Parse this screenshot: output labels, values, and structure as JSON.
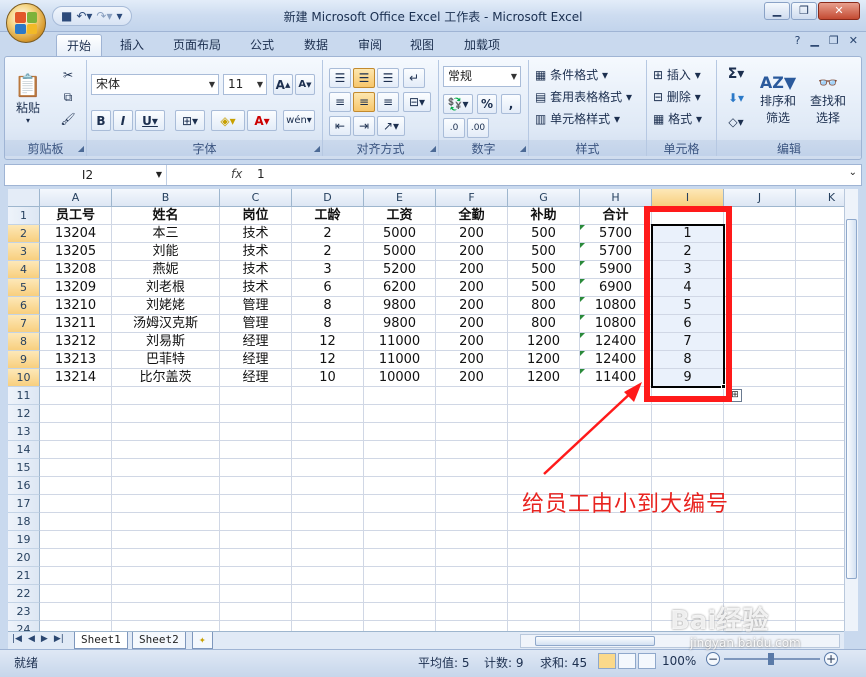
{
  "window": {
    "title": "新建 Microsoft Office Excel 工作表 - Microsoft Excel"
  },
  "ribbon_tabs": [
    "开始",
    "插入",
    "页面布局",
    "公式",
    "数据",
    "审阅",
    "视图",
    "加载项"
  ],
  "ribbon": {
    "clipboard": {
      "paste_label": "粘贴",
      "group_label": "剪贴板"
    },
    "font": {
      "font_name": "宋体",
      "font_size": "11",
      "group_label": "字体"
    },
    "alignment": {
      "group_label": "对齐方式"
    },
    "number": {
      "format": "常规",
      "group_label": "数字"
    },
    "styles": {
      "conditional": "条件格式",
      "table": "套用表格格式",
      "cell_style": "单元格样式",
      "group_label": "样式"
    },
    "cells": {
      "insert": "插入",
      "delete": "删除",
      "format": "格式",
      "group_label": "单元格"
    },
    "editing": {
      "sort_line1": "排序和",
      "sort_line2": "筛选",
      "find_line1": "查找和",
      "find_line2": "选择",
      "group_label": "编辑"
    }
  },
  "formula_bar": {
    "name_box": "I2",
    "fx": "fx",
    "value": "1"
  },
  "columns": [
    "A",
    "B",
    "C",
    "D",
    "E",
    "F",
    "G",
    "H",
    "I",
    "J",
    "K"
  ],
  "rows": [
    "1",
    "2",
    "3",
    "4",
    "5",
    "6",
    "7",
    "8",
    "9",
    "10",
    "11",
    "12",
    "13",
    "14",
    "15",
    "16",
    "17",
    "18",
    "19",
    "20",
    "21",
    "22",
    "23",
    "24"
  ],
  "table": {
    "headers": [
      "员工号",
      "姓名",
      "岗位",
      "工龄",
      "工资",
      "全勤",
      "补助",
      "合计"
    ],
    "data": [
      [
        "13204",
        "本三",
        "技术",
        "2",
        "5000",
        "200",
        "500",
        "5700",
        "1"
      ],
      [
        "13205",
        "刘能",
        "技术",
        "2",
        "5000",
        "200",
        "500",
        "5700",
        "2"
      ],
      [
        "13208",
        "燕妮",
        "技术",
        "3",
        "5200",
        "200",
        "500",
        "5900",
        "3"
      ],
      [
        "13209",
        "刘老根",
        "技术",
        "6",
        "6200",
        "200",
        "500",
        "6900",
        "4"
      ],
      [
        "13210",
        "刘姥姥",
        "管理",
        "8",
        "9800",
        "200",
        "800",
        "10800",
        "5"
      ],
      [
        "13211",
        "汤姆汉克斯",
        "管理",
        "8",
        "9800",
        "200",
        "800",
        "10800",
        "6"
      ],
      [
        "13212",
        "刘易斯",
        "经理",
        "12",
        "11000",
        "200",
        "1200",
        "12400",
        "7"
      ],
      [
        "13213",
        "巴菲特",
        "经理",
        "12",
        "11000",
        "200",
        "1200",
        "12400",
        "8"
      ],
      [
        "13214",
        "比尔盖茨",
        "经理",
        "10",
        "10000",
        "200",
        "1200",
        "11400",
        "9"
      ]
    ]
  },
  "annotation": {
    "text": "给员工由小到大编号",
    "color": "#ff1a1a"
  },
  "sheet_tabs": [
    "Sheet1",
    "Sheet2"
  ],
  "status": {
    "ready": "就绪",
    "average": "平均值: 5",
    "count": "计数: 9",
    "sum": "求和: 45",
    "zoom": "100%"
  },
  "watermark": {
    "brand": "Bai经验",
    "url": "jingyan.baidu.com"
  }
}
